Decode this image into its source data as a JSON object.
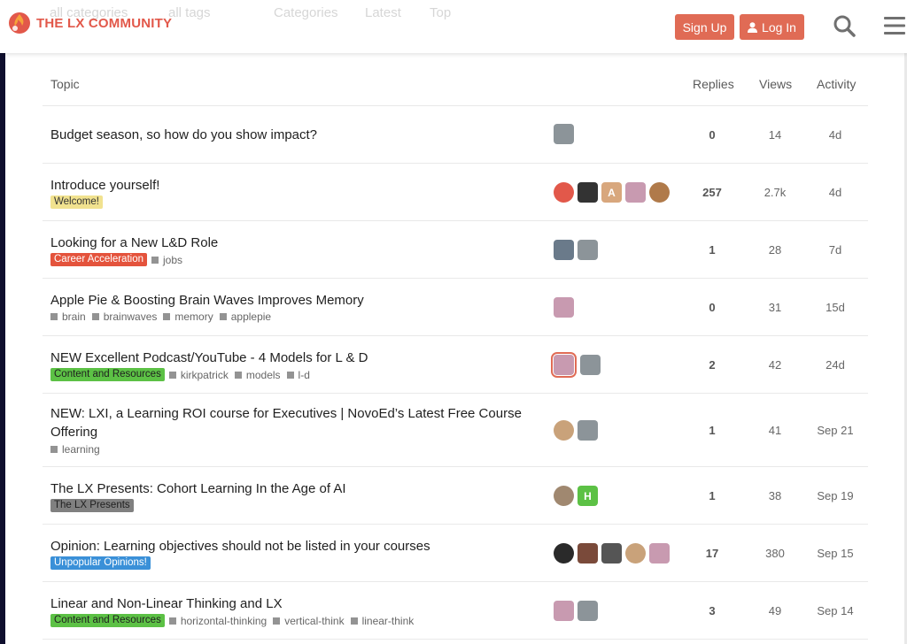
{
  "header": {
    "logo_text": "THE LX COMMUNITY",
    "ghost_nav": [
      "all categories",
      "all tags",
      "Categories",
      "Latest",
      "Top"
    ],
    "signup_label": "Sign Up",
    "login_label": "Log In",
    "accent_color": "#e06b55"
  },
  "table": {
    "columns": {
      "topic": "Topic",
      "replies": "Replies",
      "views": "Views",
      "activity": "Activity"
    }
  },
  "topics": [
    {
      "title": "Budget season, so how do you show impact?",
      "replies": "0",
      "views": "14",
      "activity": "4d"
    },
    {
      "title": "Introduce yourself!",
      "category": "Welcome!",
      "replies": "257",
      "views": "2.7k",
      "activity": "4d",
      "avatar_letter": "A"
    },
    {
      "title": "Looking for a New L&D Role",
      "category": "Career Acceleration",
      "tags": [
        "jobs"
      ],
      "replies": "1",
      "views": "28",
      "activity": "7d"
    },
    {
      "title": "Apple Pie & Boosting Brain Waves Improves Memory",
      "tags": [
        "brain",
        "brainwaves",
        "memory",
        "applepie"
      ],
      "replies": "0",
      "views": "31",
      "activity": "15d"
    },
    {
      "title": "NEW Excellent Podcast/YouTube - 4 Models for L & D",
      "category": "Content and Resources",
      "tags": [
        "kirkpatrick",
        "models",
        "l-d"
      ],
      "replies": "2",
      "views": "42",
      "activity": "24d"
    },
    {
      "title": "NEW: LXI, a Learning ROI course for Executives | NovoEd’s Latest Free Course Offering",
      "tags": [
        "learning"
      ],
      "replies": "1",
      "views": "41",
      "activity": "Sep 21"
    },
    {
      "title": "The LX Presents: Cohort Learning In the Age of AI",
      "category": "The LX Presents",
      "replies": "1",
      "views": "38",
      "activity": "Sep 19",
      "avatar_letter": "H"
    },
    {
      "title": "Opinion: Learning objectives should not be listed in your courses",
      "category": "Unpopular Opinions!",
      "replies": "17",
      "views": "380",
      "activity": "Sep 15"
    },
    {
      "title": "Linear and Non-Linear Thinking and LX",
      "category": "Content and Resources",
      "tags": [
        "horizontal-thinking",
        "vertical-think",
        "linear-think"
      ],
      "replies": "3",
      "views": "49",
      "activity": "Sep 14"
    }
  ],
  "category_colors": {
    "welcome": "#f1e28f",
    "career": "#e4533c",
    "content": "#5cc145",
    "lxpresents": "#808080",
    "unpopular": "#3a90d8"
  },
  "icons": [
    "logo-flame-icon",
    "user-icon",
    "search-icon",
    "hamburger-menu-icon",
    "tag-square-icon"
  ]
}
